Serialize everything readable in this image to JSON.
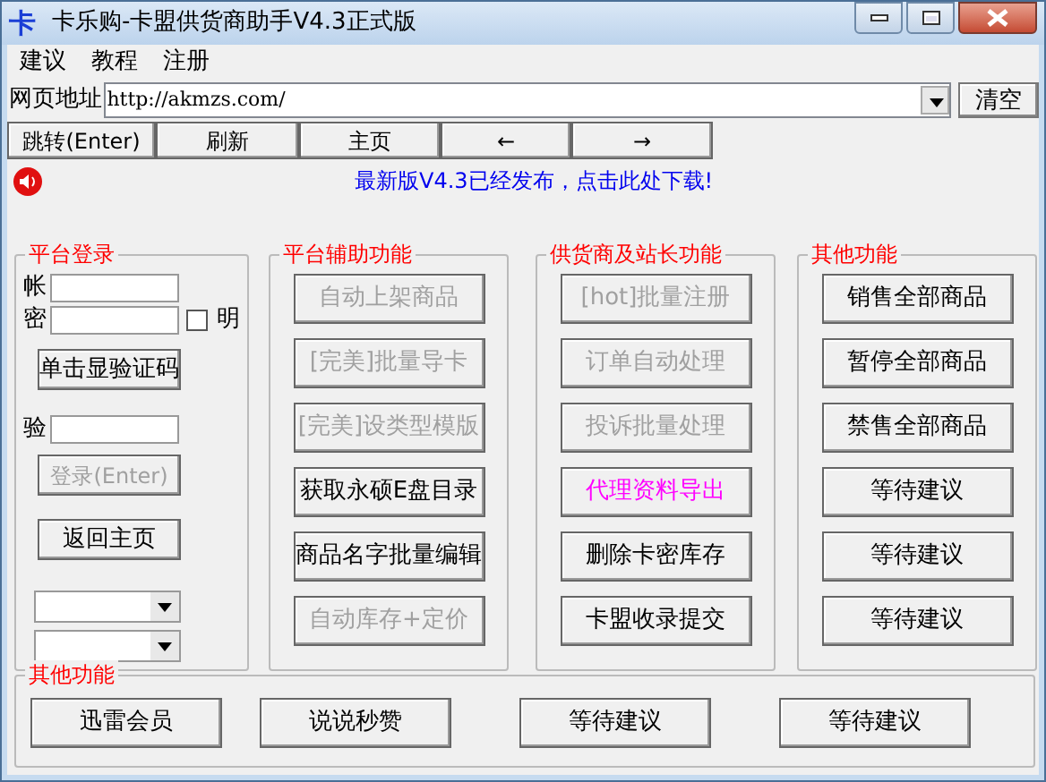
{
  "window": {
    "title": "卡乐购-卡盟供货商助手V4.3正式版",
    "app_icon_text": "卡"
  },
  "menu": [
    "建议",
    "教程",
    "注册"
  ],
  "address": {
    "label": "网页地址",
    "value": "http://akmzs.com/",
    "clear_button": "清空"
  },
  "nav_buttons": [
    "跳转(Enter)",
    "刷新",
    "主页",
    "←",
    "→"
  ],
  "notice": "最新版V4.3已经发布，点击此处下载!",
  "login": {
    "title": "平台登录",
    "account_label": "帐",
    "password_label": "密",
    "show_label": "明",
    "show_checked": false,
    "captcha_button": "单击显验证码",
    "captcha_label": "验",
    "login_button": {
      "label": "登录(Enter)",
      "disabled": true
    },
    "home_button": "返回主页"
  },
  "groups": [
    {
      "title": "平台辅助功能",
      "buttons": [
        {
          "label": "自动上架商品",
          "kind": "disabled"
        },
        {
          "label": "[完美]批量导卡",
          "kind": "disabled"
        },
        {
          "label": "[完美]设类型模版",
          "kind": "disabled"
        },
        {
          "label": "获取永硕E盘目录",
          "kind": "normal"
        },
        {
          "label": "商品名字批量编辑",
          "kind": "normal"
        },
        {
          "label": "自动库存+定价",
          "kind": "disabled"
        }
      ]
    },
    {
      "title": "供货商及站长功能",
      "buttons": [
        {
          "label": "[hot]批量注册",
          "kind": "disabled"
        },
        {
          "label": "订单自动处理",
          "kind": "disabled"
        },
        {
          "label": "投诉批量处理",
          "kind": "disabled"
        },
        {
          "label": "代理资料导出",
          "kind": "highlight"
        },
        {
          "label": "删除卡密库存",
          "kind": "normal"
        },
        {
          "label": "卡盟收录提交",
          "kind": "normal"
        }
      ]
    },
    {
      "title": "其他功能",
      "buttons": [
        {
          "label": "销售全部商品",
          "kind": "normal"
        },
        {
          "label": "暂停全部商品",
          "kind": "normal"
        },
        {
          "label": "禁售全部商品",
          "kind": "normal"
        },
        {
          "label": "等待建议",
          "kind": "normal"
        },
        {
          "label": "等待建议",
          "kind": "normal"
        },
        {
          "label": "等待建议",
          "kind": "normal"
        }
      ]
    }
  ],
  "bottom_group": {
    "title": "其他功能",
    "buttons": [
      "迅雷会员",
      "说说秒赞",
      "等待建议",
      "等待建议"
    ]
  }
}
